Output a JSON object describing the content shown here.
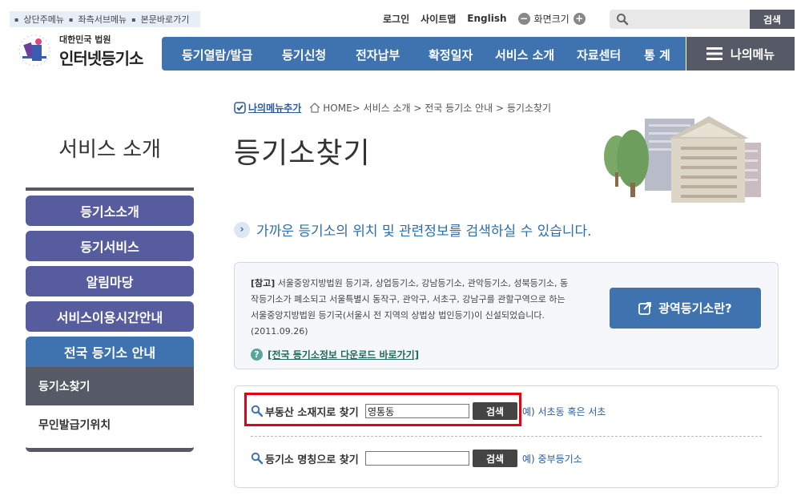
{
  "skip_links": [
    "상단주메뉴",
    "좌측서브메뉴",
    "본문바로가기"
  ],
  "util": {
    "login": "로그인",
    "sitemap": "사이트맵",
    "english": "English",
    "zoom_label": "화면크기"
  },
  "top_search": {
    "placeholder": "",
    "button": "검색"
  },
  "logo": {
    "sub": "대한민국 법원",
    "main": "인터넷등기소"
  },
  "gnb": [
    "등기열람/발급",
    "등기신청",
    "전자납부",
    "확정일자",
    "서비스 소개",
    "자료센터",
    "통 계"
  ],
  "my_menu": "나의메뉴",
  "lnb": {
    "title": "서비스 소개",
    "items": [
      "등기소소개",
      "등기서비스",
      "알림마당",
      "서비스이용시간안내",
      "전국 등기소 안내"
    ],
    "sub_items": [
      "등기소찾기",
      "무인발급기위치"
    ]
  },
  "breadcrumb": {
    "add_menu": "나의메뉴추가",
    "path": "HOME> 서비스 소개 > 전국 등기소 안내 > 등기소찾기"
  },
  "page_title": "등기소찾기",
  "intro": "가까운 등기소의 위치 및 관련정보를 검색하실 수 있습니다.",
  "note": {
    "tag": "[참고]",
    "text": " 서울중앙지방법원 등기과, 상업등기소, 강남등기소, 관악등기소, 성북등기소, 동작등기소가 폐소되고 서울특별시 동작구, 관악구, 서초구, 강남구를 관할구역으로 하는 서울중앙지방법원 등기국(서울시 전 지역의 상법상 법인등기)이 신설되었습니다. (2011.09.26)",
    "link": "[전국 등기소정보 다운로드 바로가기]",
    "button": "광역등기소란?"
  },
  "search": {
    "address": {
      "label": "부동산 소재지로 찾기",
      "value": "영통동",
      "button": "검색",
      "example": "예) 서초동 혹은 서초"
    },
    "name": {
      "label": "등기소 명칭으로 찾기",
      "value": "",
      "button": "검색",
      "example": "예) 중부등기소"
    }
  },
  "colors": {
    "nav_blue": "#3e73b0",
    "lnb_purple": "#565c9e",
    "dark_gray": "#555a66",
    "highlight_red": "#e60012"
  }
}
